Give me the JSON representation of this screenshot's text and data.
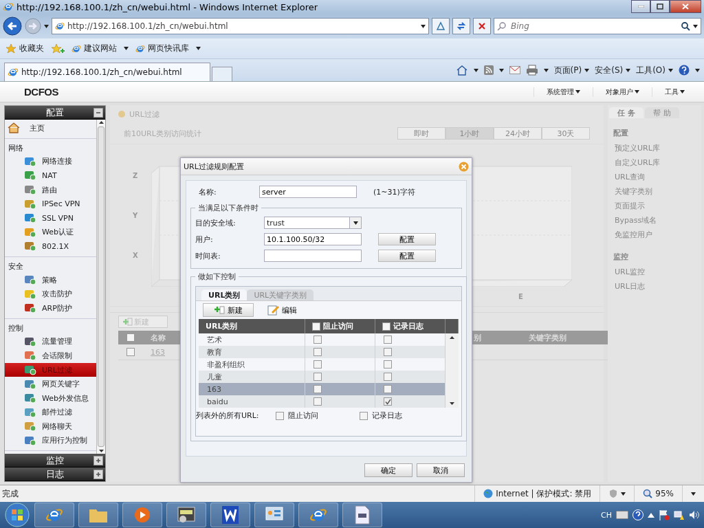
{
  "browser": {
    "title": "http://192.168.100.1/zh_cn/webui.html - Windows Internet Explorer",
    "address": "http://192.168.100.1/zh_cn/webui.html",
    "search": {
      "placeholder": "Bing"
    },
    "favorites": [
      "收藏夹",
      "建议网站",
      "网页快讯库"
    ],
    "tab": "http://192.168.100.1/zh_cn/webui.html",
    "commands": [
      "页面(P)",
      "安全(S)",
      "工具(O)"
    ]
  },
  "app": {
    "logo": "DCFOS",
    "menus": [
      "系统管理",
      "对象用户",
      "工具"
    ]
  },
  "sidebar": {
    "sections": [
      {
        "title": "配置",
        "expanded": true,
        "groups": [
          {
            "items": [
              {
                "label": "主页",
                "selected": false
              }
            ]
          },
          {
            "title": "网络",
            "items": [
              {
                "label": "网络连接",
                "selected": false
              },
              {
                "label": "NAT",
                "selected": false
              },
              {
                "label": "路由",
                "selected": false
              },
              {
                "label": "IPSec VPN",
                "selected": false
              },
              {
                "label": "SSL VPN",
                "selected": false
              },
              {
                "label": "Web认证",
                "selected": false
              },
              {
                "label": "802.1X",
                "selected": false
              }
            ]
          },
          {
            "title": "安全",
            "items": [
              {
                "label": "策略",
                "selected": false
              },
              {
                "label": "攻击防护",
                "selected": false
              },
              {
                "label": "ARP防护",
                "selected": false
              }
            ]
          },
          {
            "title": "控制",
            "items": [
              {
                "label": "流量管理",
                "selected": false
              },
              {
                "label": "会话限制",
                "selected": false
              },
              {
                "label": "URL过滤",
                "selected": true
              },
              {
                "label": "网页关键字",
                "selected": false
              },
              {
                "label": "Web外发信息",
                "selected": false
              },
              {
                "label": "邮件过滤",
                "selected": false
              },
              {
                "label": "网络聊天",
                "selected": false
              },
              {
                "label": "应用行为控制",
                "selected": false
              }
            ]
          }
        ]
      },
      {
        "title": "监控",
        "expanded": false
      },
      {
        "title": "日志",
        "expanded": false
      }
    ]
  },
  "main": {
    "title": "URL过滤",
    "subtitle": "前10URL类别访问统计",
    "ranges": [
      {
        "label": "即时",
        "selected": false
      },
      {
        "label": "1小时",
        "selected": true
      },
      {
        "label": "24小时",
        "selected": false
      },
      {
        "label": "30天",
        "selected": false
      }
    ],
    "chart_axes": {
      "vertical": [
        "Z",
        "Y",
        "X"
      ],
      "horizontal": "E"
    },
    "new_button": "新建",
    "table": {
      "columns": [
        "名称",
        "别",
        "关键字类别"
      ],
      "header_checked": false,
      "rows": [
        {
          "checked": false,
          "name": "163"
        }
      ]
    }
  },
  "task_panel": {
    "tabs": [
      {
        "label": "任 务",
        "selected": true
      },
      {
        "label": "帮 助",
        "selected": false
      }
    ],
    "groups": [
      {
        "title": "配置",
        "links": [
          "预定义URL库",
          "自定义URL库",
          "URL查询",
          "关键字类别",
          "页面提示",
          "Bypass域名",
          "免监控用户"
        ]
      },
      {
        "title": "监控",
        "links": [
          "URL监控",
          "URL日志"
        ]
      }
    ]
  },
  "dialog": {
    "title": "URL过滤规则配置",
    "name": {
      "label": "名称:",
      "value": "server",
      "hint": "(1~31)字符"
    },
    "conditions": {
      "legend": "当满足以下条件时",
      "zone": {
        "label": "目的安全域:",
        "value": "trust"
      },
      "user": {
        "label": "用户:",
        "value": "10.1.100.50/32",
        "button": "配置"
      },
      "schedule": {
        "label": "时间表:",
        "button": "配置"
      }
    },
    "controls": {
      "legend": "做如下控制",
      "tabs": [
        {
          "label": "URL类别",
          "selected": true
        },
        {
          "label": "URL关键字类别",
          "selected": false
        }
      ],
      "toolbar": [
        {
          "kind": "button",
          "label": "新建"
        },
        {
          "kind": "link",
          "label": "编辑"
        }
      ],
      "columns": [
        {
          "label": "URL类别"
        },
        {
          "label": "阻止访问",
          "checked": false
        },
        {
          "label": "记录日志",
          "checked": false
        }
      ],
      "rows": [
        {
          "category": "艺术",
          "block": false,
          "log": false,
          "selected": false
        },
        {
          "category": "教育",
          "block": false,
          "log": false,
          "selected": false
        },
        {
          "category": "非盈利组织",
          "block": false,
          "log": false,
          "selected": false
        },
        {
          "category": "儿童",
          "block": false,
          "log": false,
          "selected": false
        },
        {
          "category": "163",
          "block": false,
          "log": false,
          "selected": true
        },
        {
          "category": "baidu",
          "block": false,
          "log": true,
          "selected": false
        }
      ],
      "others": {
        "label": "列表外的所有URL:",
        "block": {
          "label": "阻止访问",
          "checked": false
        },
        "log": {
          "label": "记录日志",
          "checked": false
        }
      }
    },
    "buttons": [
      "确定",
      "取消"
    ]
  },
  "status_bar": {
    "text": "完成",
    "zone": "Internet | 保护模式: 禁用",
    "zoom": "95%"
  },
  "taskbar": {
    "language": "CH"
  }
}
